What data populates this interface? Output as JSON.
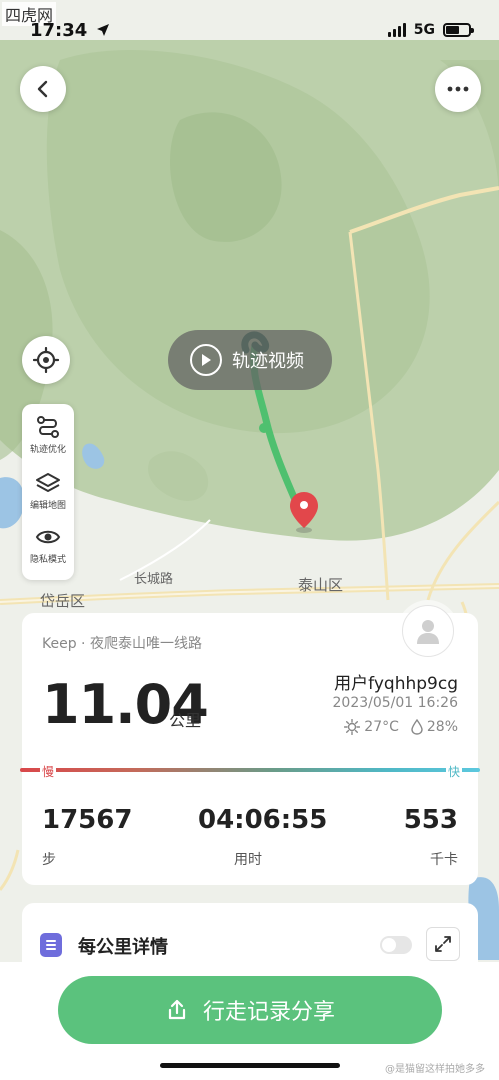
{
  "watermark_top": "四虎网",
  "status": {
    "time": "17:34",
    "network": "5G"
  },
  "map": {
    "video_label": "轨迹视频",
    "tools": [
      {
        "label": "轨迹优化",
        "icon": "route-optimize-icon"
      },
      {
        "label": "编辑地图",
        "icon": "layers-icon"
      },
      {
        "label": "隐私模式",
        "icon": "eye-icon"
      }
    ],
    "places": [
      "长城路",
      "岱岳区",
      "泰山区"
    ]
  },
  "summary": {
    "subtitle": "Keep · 夜爬泰山唯一线路",
    "distance": "11.04",
    "distance_unit": "公里",
    "user": "用户fyqhhp9cg",
    "datetime": "2023/05/01 16:26",
    "temperature": "27°C",
    "humidity": "28%",
    "pace_slow": "慢",
    "pace_fast": "快",
    "stats": [
      {
        "value": "17567",
        "label": "步"
      },
      {
        "value": "04:06:55",
        "label": "用时"
      },
      {
        "value": "553",
        "label": "千卡"
      }
    ]
  },
  "km_detail": {
    "title": "每公里详情"
  },
  "share_button": "行走记录分享",
  "watermark_bottom": "@是猫留这样拍她多多",
  "colors": {
    "accent": "#5bc27d",
    "track": "#4fc06f",
    "pin": "#e2474b",
    "pace_slow": "#d9474a",
    "pace_fast": "#4fb8c6"
  }
}
